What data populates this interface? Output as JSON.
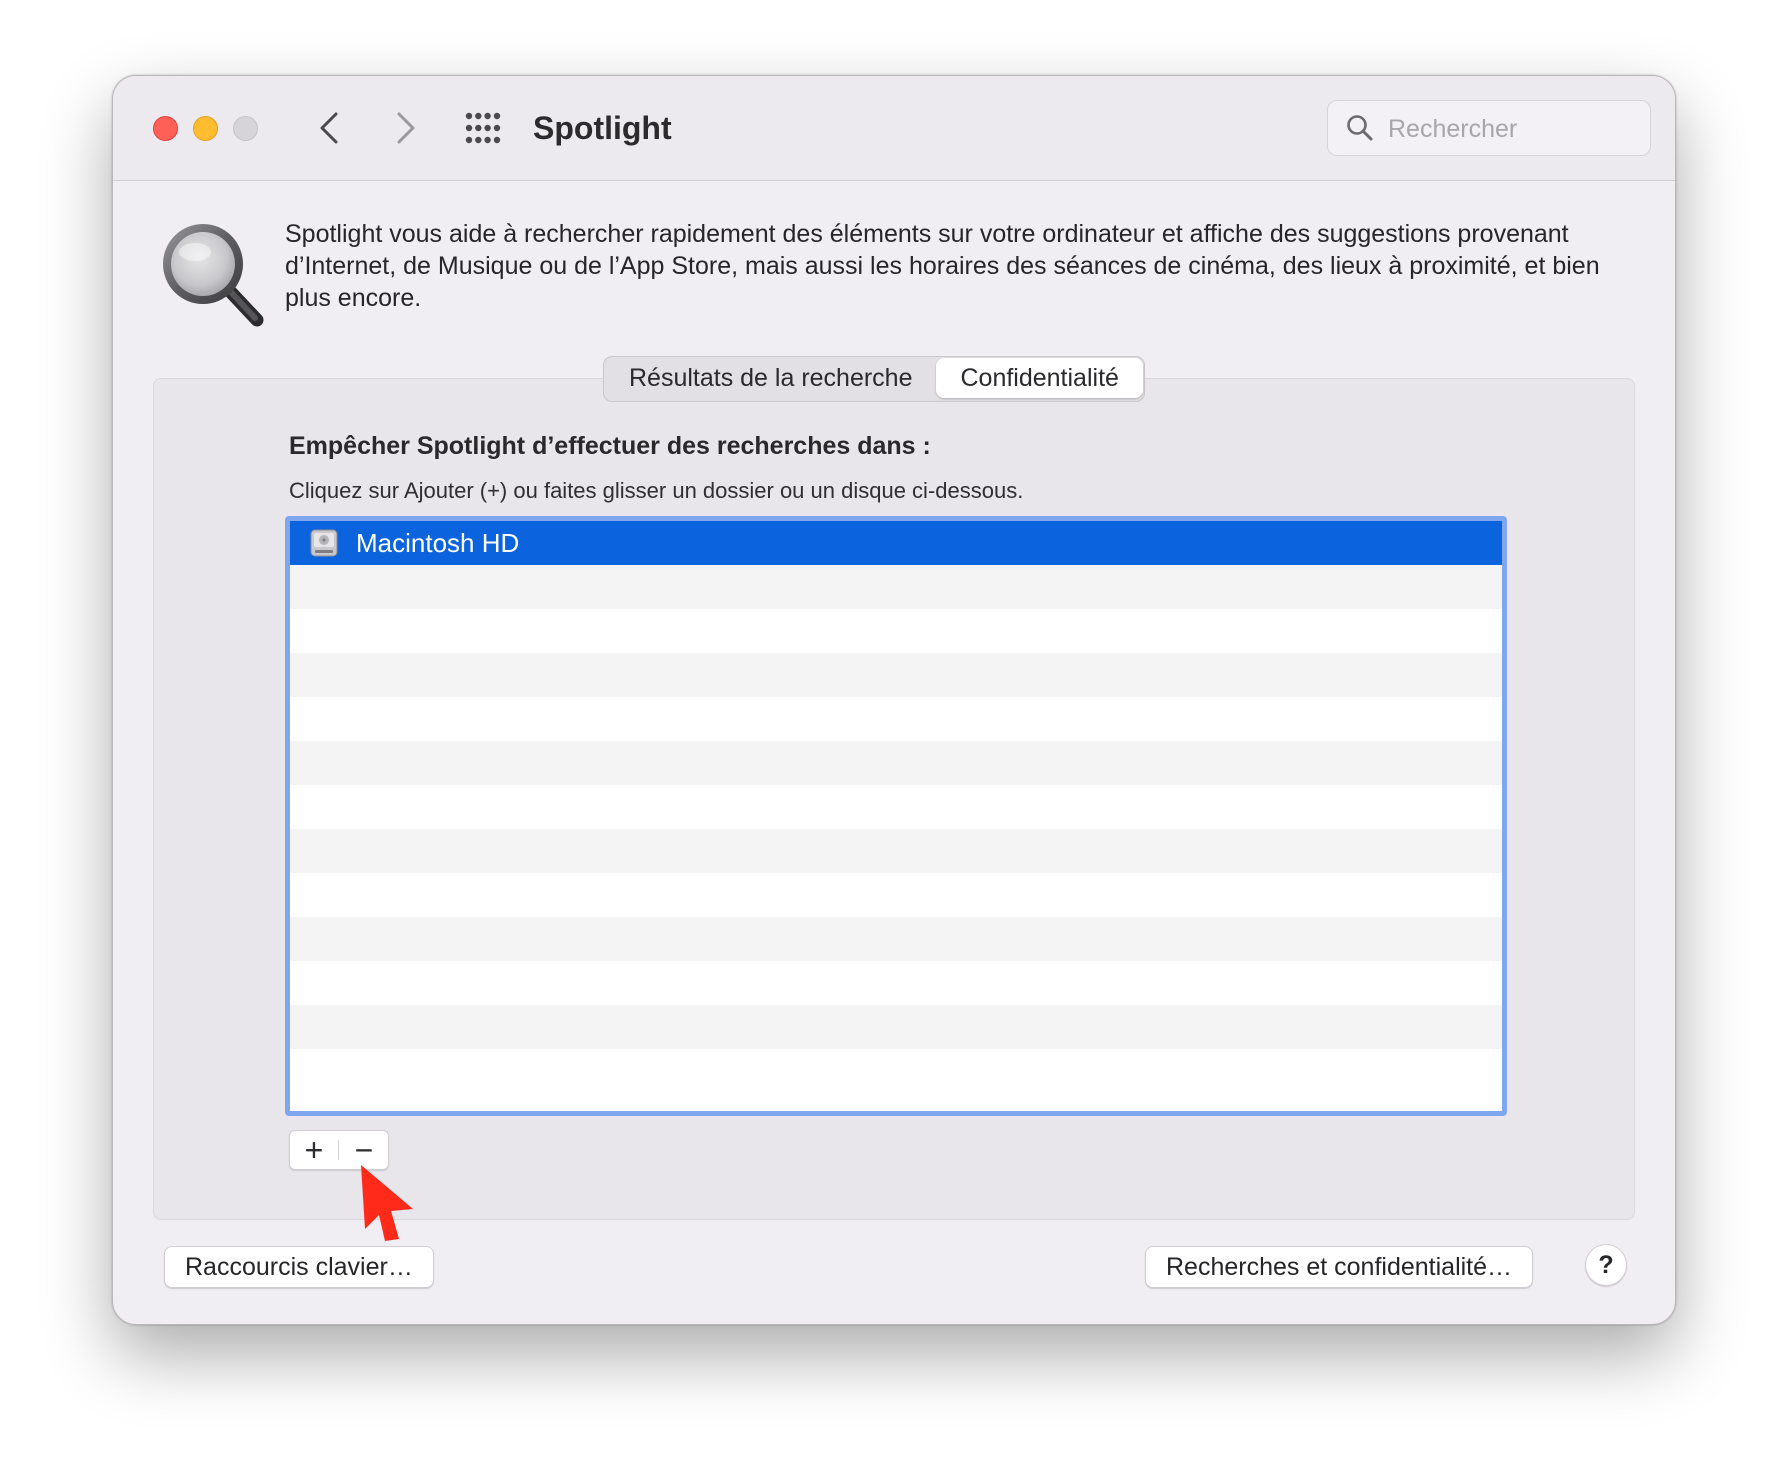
{
  "window": {
    "title": "Spotlight",
    "search_placeholder": "Rechercher"
  },
  "header": {
    "description": "Spotlight vous aide à rechercher rapidement des éléments sur votre ordinateur et affiche des suggestions provenant d’Internet, de Musique ou de l’App Store, mais aussi les horaires des séances de cinéma, des lieux à proximité, et bien plus encore."
  },
  "tabs": [
    {
      "label": "Résultats de la recherche",
      "active": false
    },
    {
      "label": "Confidentialité",
      "active": true
    }
  ],
  "privacy": {
    "section_title": "Empêcher Spotlight d’effectuer des recherches dans :",
    "instructions": "Cliquez sur Ajouter (+) ou faites glisser un dossier ou un disque ci-dessous.",
    "items": [
      {
        "label": "Macintosh HD",
        "selected": true,
        "icon": "hard-drive-icon"
      }
    ],
    "add_label": "+",
    "remove_label": "−"
  },
  "footer": {
    "shortcuts_label": "Raccourcis clavier…",
    "privacy_label": "Recherches et confidentialité…",
    "help_label": "?"
  },
  "colors": {
    "selection": "#0b63de",
    "focus_ring": "#7fa6ef",
    "pointer": "#ff2a1a"
  }
}
